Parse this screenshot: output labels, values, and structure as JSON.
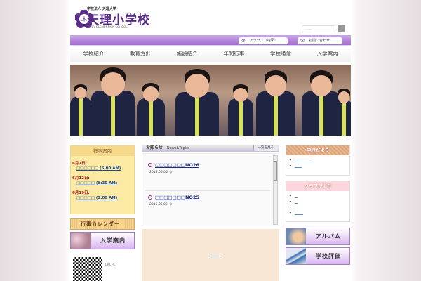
{
  "header": {
    "org": "学校法人 天理大学",
    "school_name": "天理小学校",
    "school_name_en": "TENRI ELEMENTARY SCHOOL",
    "search_placeholder": "......"
  },
  "utility": {
    "access": "アクセス（地図）",
    "contact": "お問い合わせ"
  },
  "nav": [
    "学校紹介",
    "教育方針",
    "施設紹介",
    "年間行事",
    "学校通信",
    "入学案内"
  ],
  "events": {
    "title": "行事案内",
    "items": [
      {
        "date": "6月7日:",
        "link": "□□□□□□ (5:00 AM)"
      },
      {
        "date": "6月12日:",
        "link": "□□□□□ (8:30 AM)"
      },
      {
        "date": "6月19日:",
        "link": "□□□□□ (9:00 AM)"
      }
    ]
  },
  "calendar_button": "行事カレンダー",
  "admission_button": "入学案内",
  "qr_label": "URL PC",
  "news": {
    "title": "お知らせ",
    "subtitle": "News&Topics",
    "more": "一覧を見る",
    "items": [
      {
        "title": "□□□□□□□NO26",
        "date": "2015.06.05（）"
      },
      {
        "title": "□□□□□□□NO25",
        "date": "2015.06.03（）"
      }
    ]
  },
  "right": {
    "newsletter_title": "学校だより",
    "club_title": "クラブだより",
    "album": "アルバム",
    "evaluation": "学校評価"
  },
  "colors": {
    "brand_purple": "#5a2d8a",
    "band": "#a46cd3"
  }
}
